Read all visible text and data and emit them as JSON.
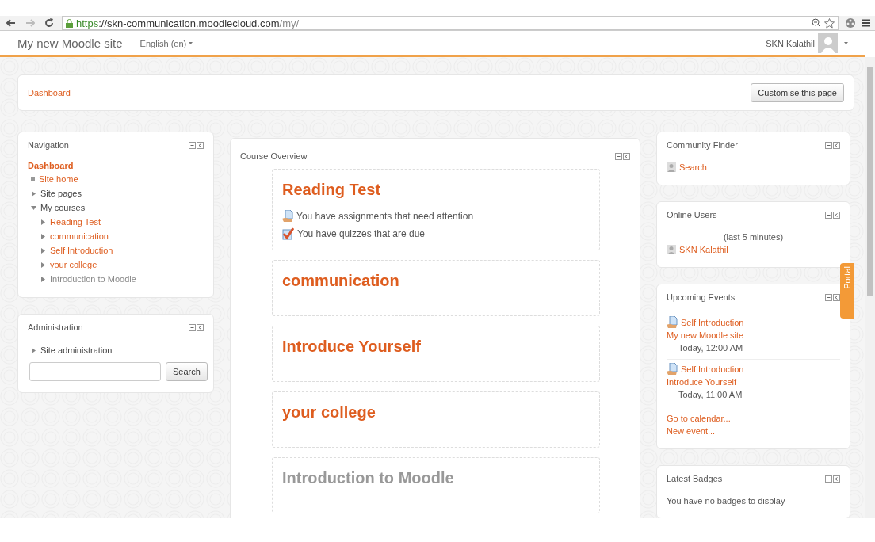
{
  "browser": {
    "url_scheme": "https",
    "url_host": "://skn-communication.moodlecloud.com",
    "url_path": "/my/"
  },
  "navbar": {
    "site_name": "My new Moodle site",
    "language": "English (en)",
    "user_name": "SKN Kalathil"
  },
  "breadcrumb": {
    "items": [
      "Dashboard"
    ],
    "button": "Customise this page"
  },
  "navigation": {
    "title": "Navigation",
    "root": "Dashboard",
    "items": [
      {
        "label": "Site home",
        "kind": "leaf",
        "link": true,
        "dimmed": false
      },
      {
        "label": "Site pages",
        "kind": "branch",
        "expanded": false,
        "link": false,
        "dimmed": false
      },
      {
        "label": "My courses",
        "kind": "branch",
        "expanded": true,
        "link": false,
        "dimmed": false,
        "children": [
          {
            "label": "Reading Test",
            "kind": "branch",
            "expanded": false,
            "link": true,
            "dimmed": false
          },
          {
            "label": "communication",
            "kind": "branch",
            "expanded": false,
            "link": true,
            "dimmed": false
          },
          {
            "label": "Self Introduction",
            "kind": "branch",
            "expanded": false,
            "link": true,
            "dimmed": false
          },
          {
            "label": "your college",
            "kind": "branch",
            "expanded": false,
            "link": true,
            "dimmed": false
          },
          {
            "label": "Introduction to Moodle",
            "kind": "branch",
            "expanded": false,
            "link": true,
            "dimmed": true
          }
        ]
      }
    ]
  },
  "administration": {
    "title": "Administration",
    "items": [
      {
        "label": "Site administration",
        "kind": "branch",
        "expanded": false,
        "link": false,
        "dimmed": false
      }
    ],
    "search_button": "Search"
  },
  "course_overview": {
    "title": "Course Overview",
    "courses": [
      {
        "name": "Reading Test",
        "dimmed": false,
        "notices": [
          {
            "kind": "assignment",
            "text": "You have assignments that need attention"
          },
          {
            "kind": "quiz",
            "text": "You have quizzes that are due"
          }
        ]
      },
      {
        "name": "communication",
        "dimmed": false
      },
      {
        "name": "Introduce Yourself",
        "dimmed": false
      },
      {
        "name": "your college",
        "dimmed": false
      },
      {
        "name": "Introduction to Moodle",
        "dimmed": true
      }
    ]
  },
  "community_finder": {
    "title": "Community Finder",
    "link": "Search"
  },
  "online_users": {
    "title": "Online Users",
    "period": "(last 5 minutes)",
    "users": [
      "SKN Kalathil"
    ]
  },
  "upcoming_events": {
    "title": "Upcoming Events",
    "events": [
      {
        "name": "Self Introduction",
        "course": "My new Moodle site",
        "time": "Today, 12:00 AM"
      },
      {
        "name": "Self Introduction",
        "course": "Introduce Yourself",
        "time": "Today, 11:00 AM"
      }
    ],
    "links": [
      "Go to calendar...",
      "New event..."
    ]
  },
  "latest_badges": {
    "title": "Latest Badges",
    "message": "You have no badges to display"
  },
  "portal_tab": {
    "label": "Portal"
  }
}
